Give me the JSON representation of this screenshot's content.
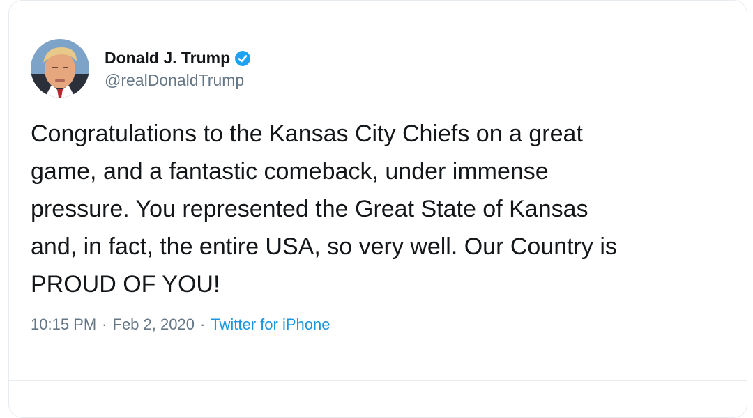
{
  "author": {
    "display_name": "Donald J. Trump",
    "handle": "@realDonaldTrump",
    "verified": true,
    "avatar_icon": "profile-photo"
  },
  "tweet": {
    "text_lines": [
      "Congratulations to the Kansas City Chiefs on a great",
      "game, and a fantastic comeback, under immense",
      "pressure. You represented the Great State of Kansas",
      "and, in fact, the entire USA, so very well. Our Country is",
      "PROUD OF YOU!"
    ]
  },
  "meta": {
    "time": "10:15 PM",
    "separator": "·",
    "date": "Feb 2, 2020",
    "source": "Twitter for iPhone"
  },
  "colors": {
    "text": "#14171a",
    "muted": "#657786",
    "link": "#1b95e0",
    "verified": "#1da1f2"
  }
}
